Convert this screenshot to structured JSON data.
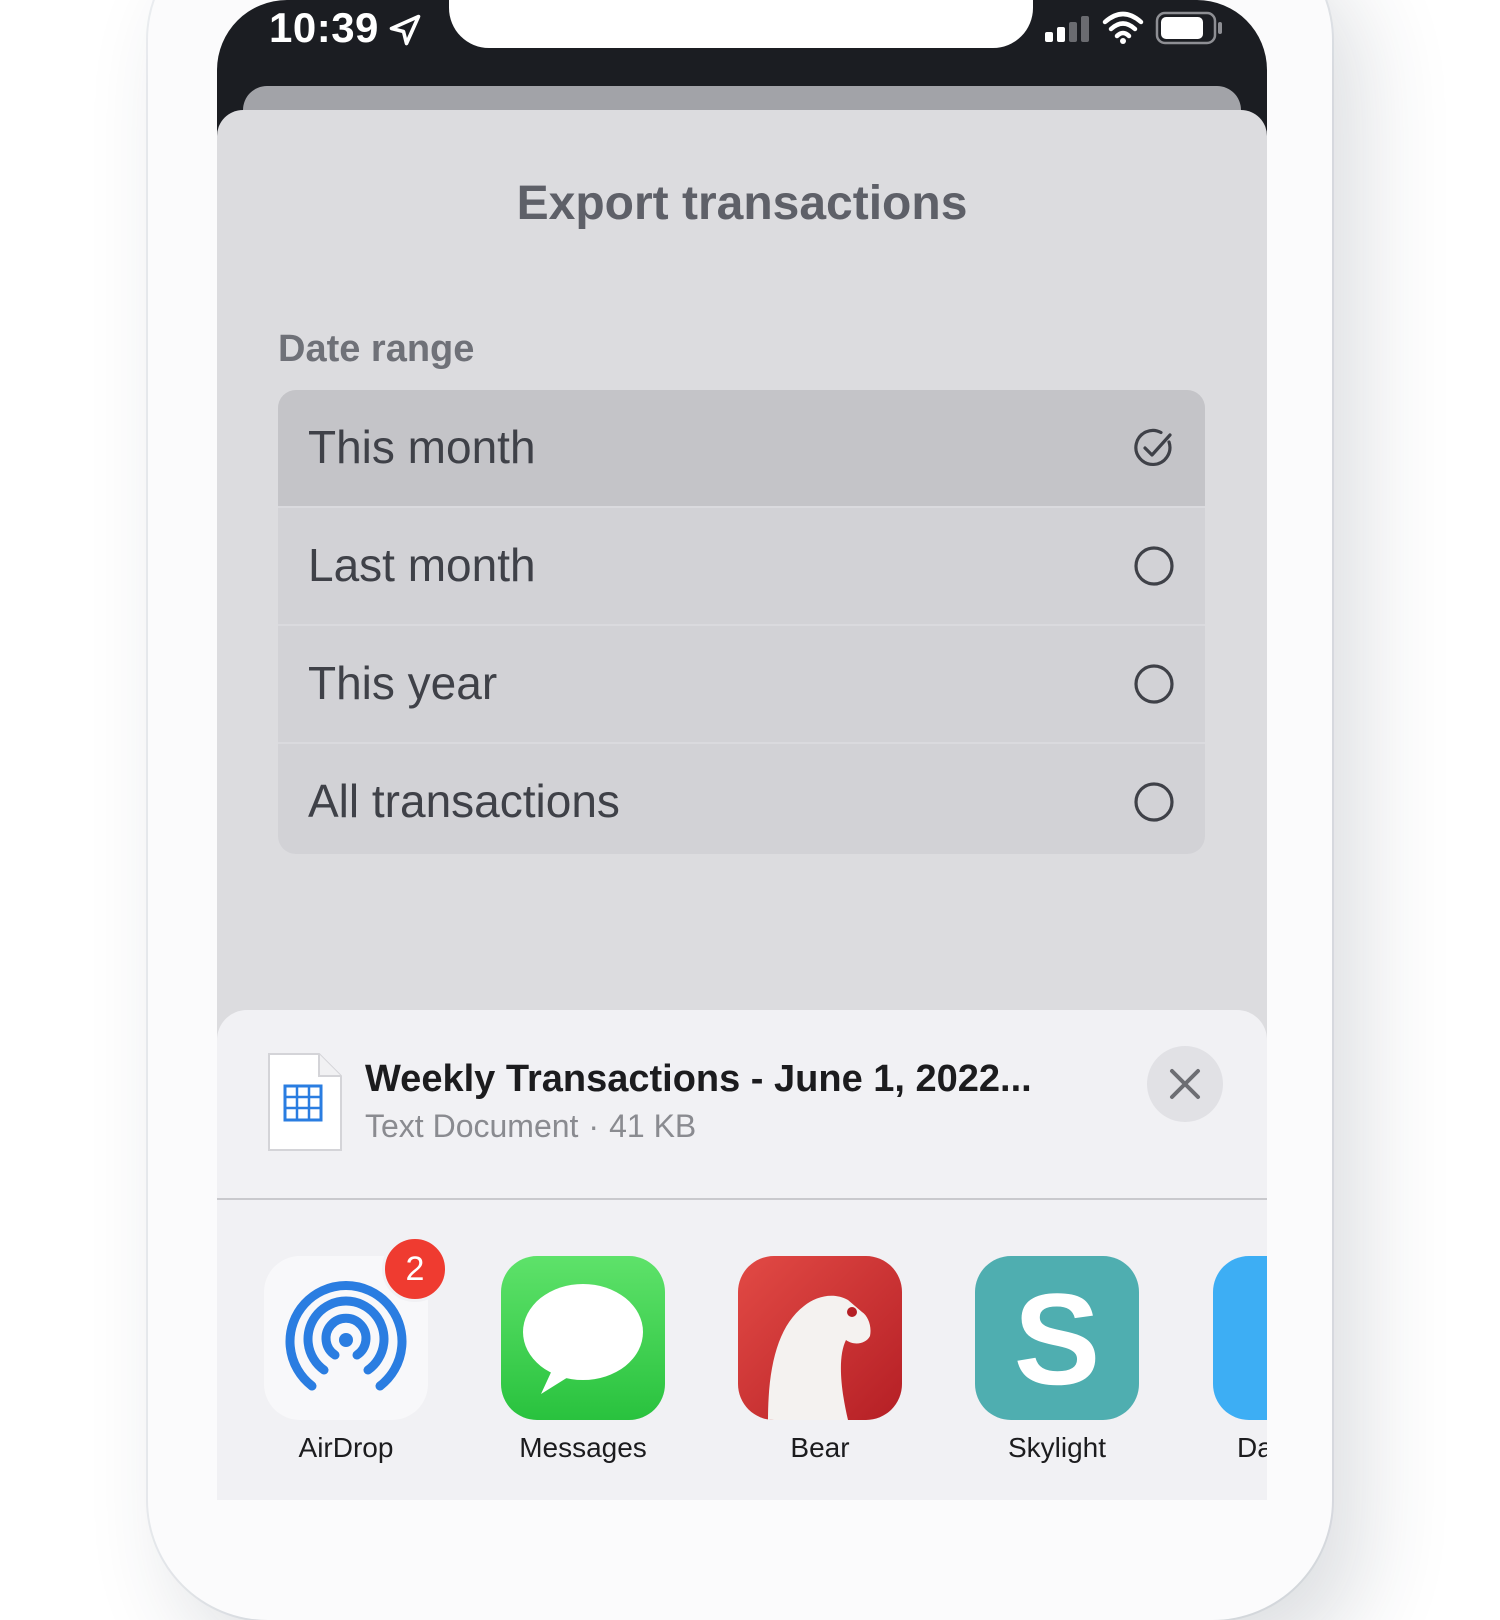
{
  "status_bar": {
    "time": "10:39",
    "icons": [
      "location-arrow-icon",
      "cellular-signal-icon",
      "wifi-icon",
      "battery-icon"
    ]
  },
  "modal": {
    "title": "Export transactions",
    "section_label": "Date range",
    "options": [
      {
        "label": "This month",
        "selected": true
      },
      {
        "label": "Last month",
        "selected": false
      },
      {
        "label": "This year",
        "selected": false
      },
      {
        "label": "All transactions",
        "selected": false
      }
    ]
  },
  "share_sheet": {
    "file": {
      "title": "Weekly Transactions - June 1, 2022...",
      "type": "Text Document",
      "separator": "·",
      "size": "41 KB"
    },
    "apps": [
      {
        "label": "AirDrop",
        "badge": "2",
        "icon": "airdrop-icon",
        "color": "#ffffff"
      },
      {
        "label": "Messages",
        "icon": "messages-icon",
        "color": "#34c759"
      },
      {
        "label": "Bear",
        "icon": "bear-icon",
        "color": "#d53232"
      },
      {
        "label": "Skylight",
        "icon": "skylight-icon",
        "color": "#4faeb0"
      },
      {
        "label": "Da",
        "icon": "partial-app-icon",
        "color": "#3daef4"
      }
    ]
  },
  "colors": {
    "accent_blue": "#2a7de1",
    "badge_red": "#ef3b30"
  }
}
